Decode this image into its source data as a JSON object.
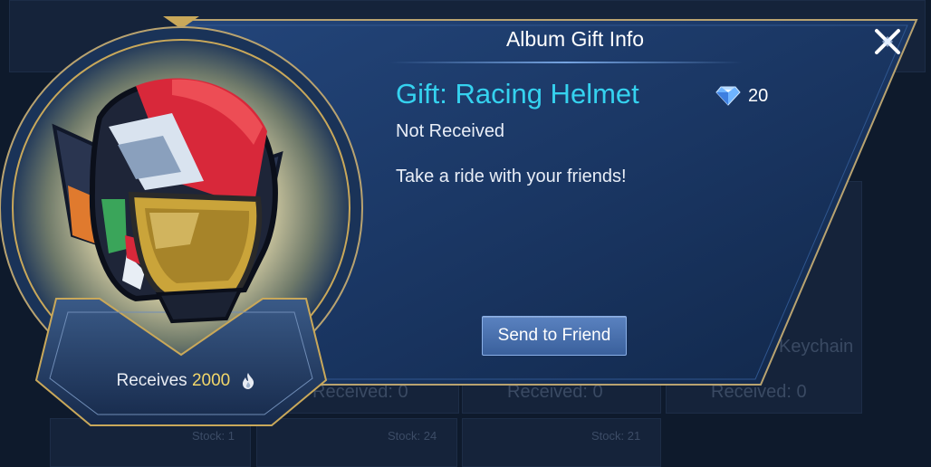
{
  "background": {
    "labels": [
      {
        "text": "Keychain"
      },
      {
        "text": "Received: 0"
      },
      {
        "text": "Received: 0"
      },
      {
        "text": "Received: 0"
      },
      {
        "text": "Stock: 1"
      },
      {
        "text": "Stock: 24"
      },
      {
        "text": "Stock: 21"
      }
    ]
  },
  "dialog": {
    "title": "Album Gift Info",
    "gift_name": "Gift: Racing Helmet",
    "price": {
      "value": "20",
      "icon": "diamond-icon"
    },
    "status": "Not Received",
    "description": "Take a ride with your friends!",
    "send_button": "Send to Friend",
    "receives": {
      "label": "Receives",
      "value": "2000",
      "icon": "flame-icon"
    }
  },
  "colors": {
    "gift_name": "#35d2ef",
    "receives_value": "#f2d76a",
    "panel": "#1b3560",
    "gold_trim": "#c9a85a"
  }
}
